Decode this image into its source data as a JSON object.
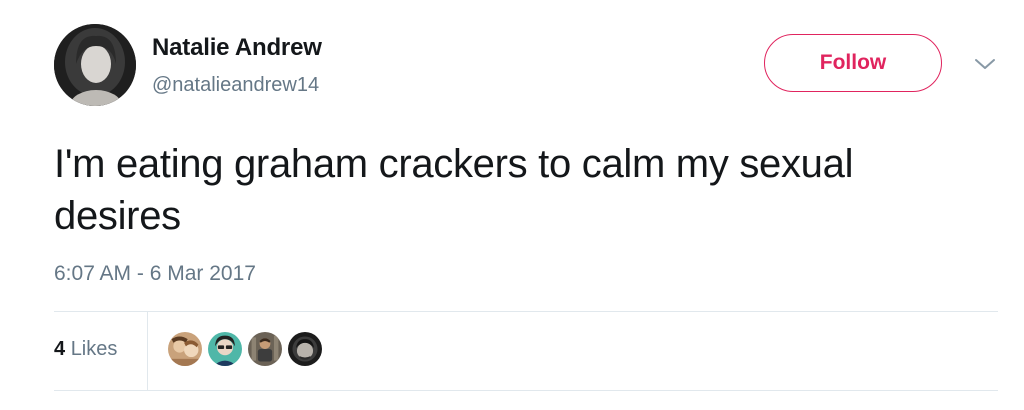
{
  "user": {
    "name": "Natalie Andrew",
    "handle": "@natalieandrew14",
    "avatar_icon": "profile-photo"
  },
  "actions": {
    "follow_label": "Follow",
    "follow_color": "#e0245e",
    "more_icon": "chevron-down-icon"
  },
  "tweet": {
    "text": "I'm eating graham crackers to calm my sexual desires",
    "timestamp": "6:07 AM - 6 Mar 2017"
  },
  "stats": {
    "likes_count": "4",
    "likes_label": "Likes",
    "likers": [
      {
        "icon": "liker-avatar-1"
      },
      {
        "icon": "liker-avatar-2"
      },
      {
        "icon": "liker-avatar-3"
      },
      {
        "icon": "liker-avatar-4"
      }
    ]
  },
  "colors": {
    "text_primary": "#14171a",
    "text_secondary": "#657786",
    "divider": "#e1e8ed"
  }
}
